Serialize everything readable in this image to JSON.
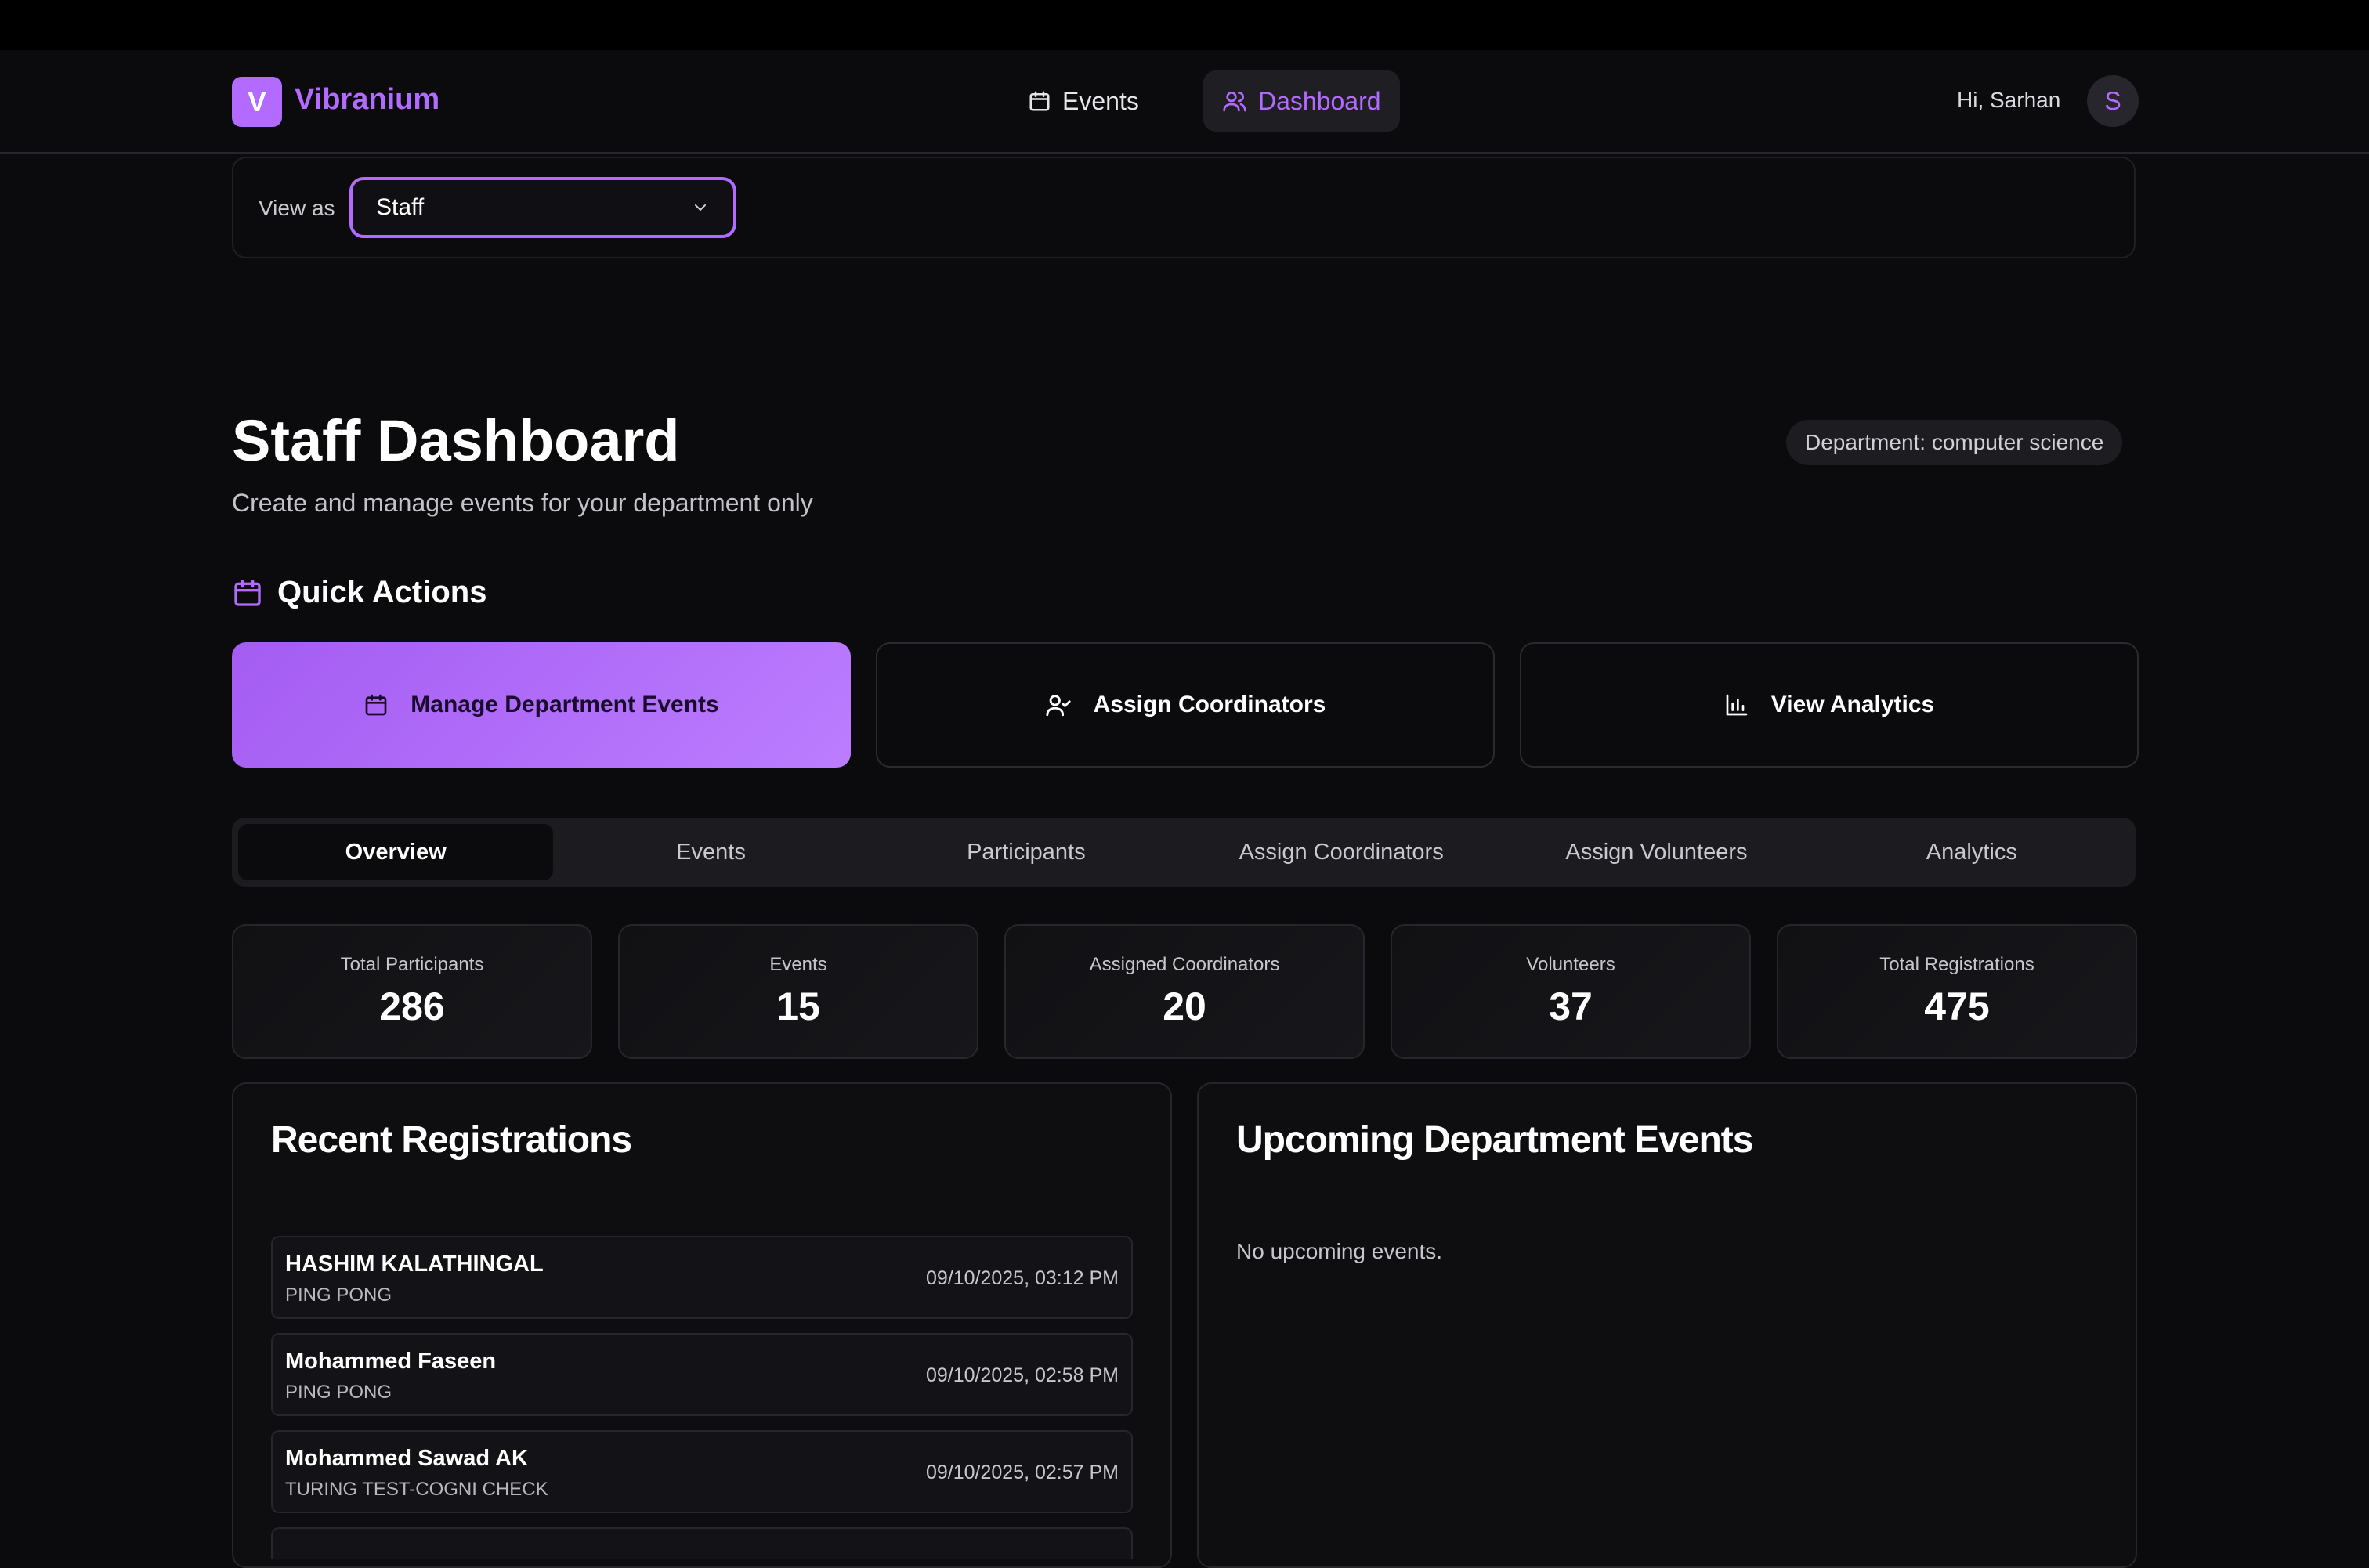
{
  "brand": {
    "logo_letter": "V",
    "name": "Vibranium",
    "accent": "#b36bff"
  },
  "nav": {
    "events_label": "Events",
    "dashboard_label": "Dashboard"
  },
  "user": {
    "greeting": "Hi, Sarhan",
    "avatar_letter": "S"
  },
  "view_as": {
    "label": "View as",
    "selected": "Staff"
  },
  "page": {
    "title": "Staff Dashboard",
    "subtitle": "Create and manage events for your department only",
    "department_badge": "Department: computer science"
  },
  "quick_actions": {
    "title": "Quick Actions",
    "buttons": [
      {
        "label": "Manage Department Events",
        "icon": "calendar-icon"
      },
      {
        "label": "Assign Coordinators",
        "icon": "user-check-icon"
      },
      {
        "label": "View Analytics",
        "icon": "bar-chart-icon"
      }
    ]
  },
  "tabs": [
    "Overview",
    "Events",
    "Participants",
    "Assign Coordinators",
    "Assign Volunteers",
    "Analytics"
  ],
  "active_tab": "Overview",
  "stats": [
    {
      "label": "Total Participants",
      "value": "286"
    },
    {
      "label": "Events",
      "value": "15"
    },
    {
      "label": "Assigned Coordinators",
      "value": "20"
    },
    {
      "label": "Volunteers",
      "value": "37"
    },
    {
      "label": "Total Registrations",
      "value": "475"
    }
  ],
  "recent_registrations": {
    "title": "Recent Registrations",
    "items": [
      {
        "name": "HASHIM KALATHINGAL",
        "event": "PING PONG",
        "time": "09/10/2025, 03:12 PM"
      },
      {
        "name": "Mohammed Faseen",
        "event": "PING PONG",
        "time": "09/10/2025, 02:58 PM"
      },
      {
        "name": "Mohammed Sawad AK",
        "event": "TURING TEST-COGNI CHECK",
        "time": "09/10/2025, 02:57 PM"
      }
    ]
  },
  "upcoming_events": {
    "title": "Upcoming Department Events",
    "empty_text": "No upcoming events."
  }
}
